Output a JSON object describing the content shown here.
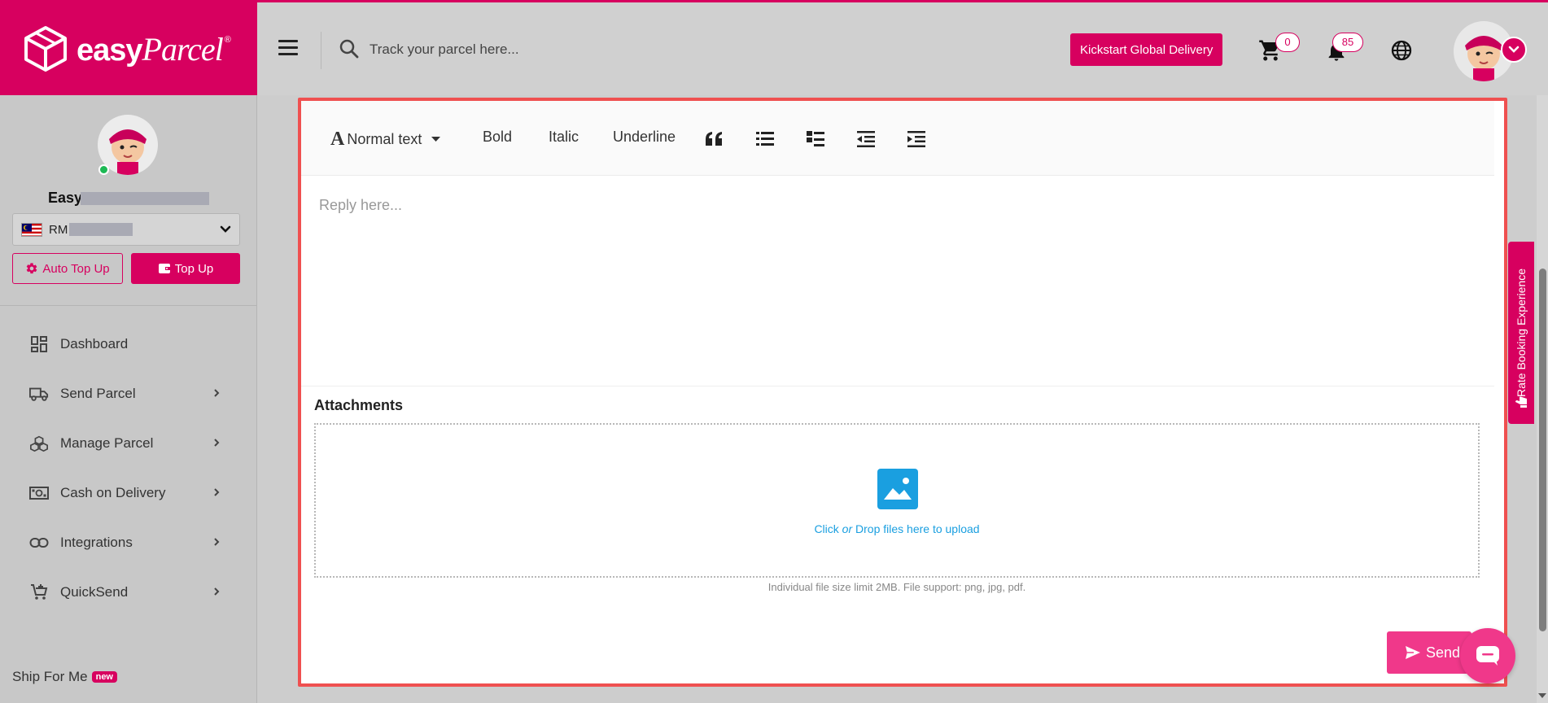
{
  "brand": {
    "name_bold": "easy",
    "name_script": "Parcel",
    "reg": "®"
  },
  "header": {
    "search_placeholder": "Track your parcel here...",
    "kickstart_label": "Kickstart Global Delivery",
    "cart_count": "0",
    "notification_count": "85"
  },
  "sidebar": {
    "user_name": "Easy",
    "wallet_currency": "RM",
    "auto_topup_label": "Auto Top Up",
    "topup_label": "Top Up",
    "nav": [
      {
        "label": "Dashboard"
      },
      {
        "label": "Send Parcel"
      },
      {
        "label": "Manage Parcel"
      },
      {
        "label": "Cash on Delivery"
      },
      {
        "label": "Integrations"
      },
      {
        "label": "QuickSend"
      }
    ],
    "ship_for_me": {
      "label": "Ship For Me",
      "badge": "new"
    }
  },
  "editor": {
    "toolbar": {
      "text_style": "Normal text",
      "bold": "Bold",
      "italic": "Italic",
      "underline": "Underline"
    },
    "reply_placeholder": "Reply here...",
    "attachments_title": "Attachments",
    "drop_click": "Click",
    "drop_or": "or",
    "drop_rest": "Drop files here to upload",
    "file_hint": "Individual file size limit 2MB. File support: png, jpg, pdf.",
    "send_label": "Send"
  },
  "side_tab": {
    "label": "Rate Booking Experience"
  },
  "colors": {
    "brand": "#d7005f",
    "send": "#f0388a",
    "focus_border": "#ef5050",
    "link": "#1a9fe0"
  }
}
